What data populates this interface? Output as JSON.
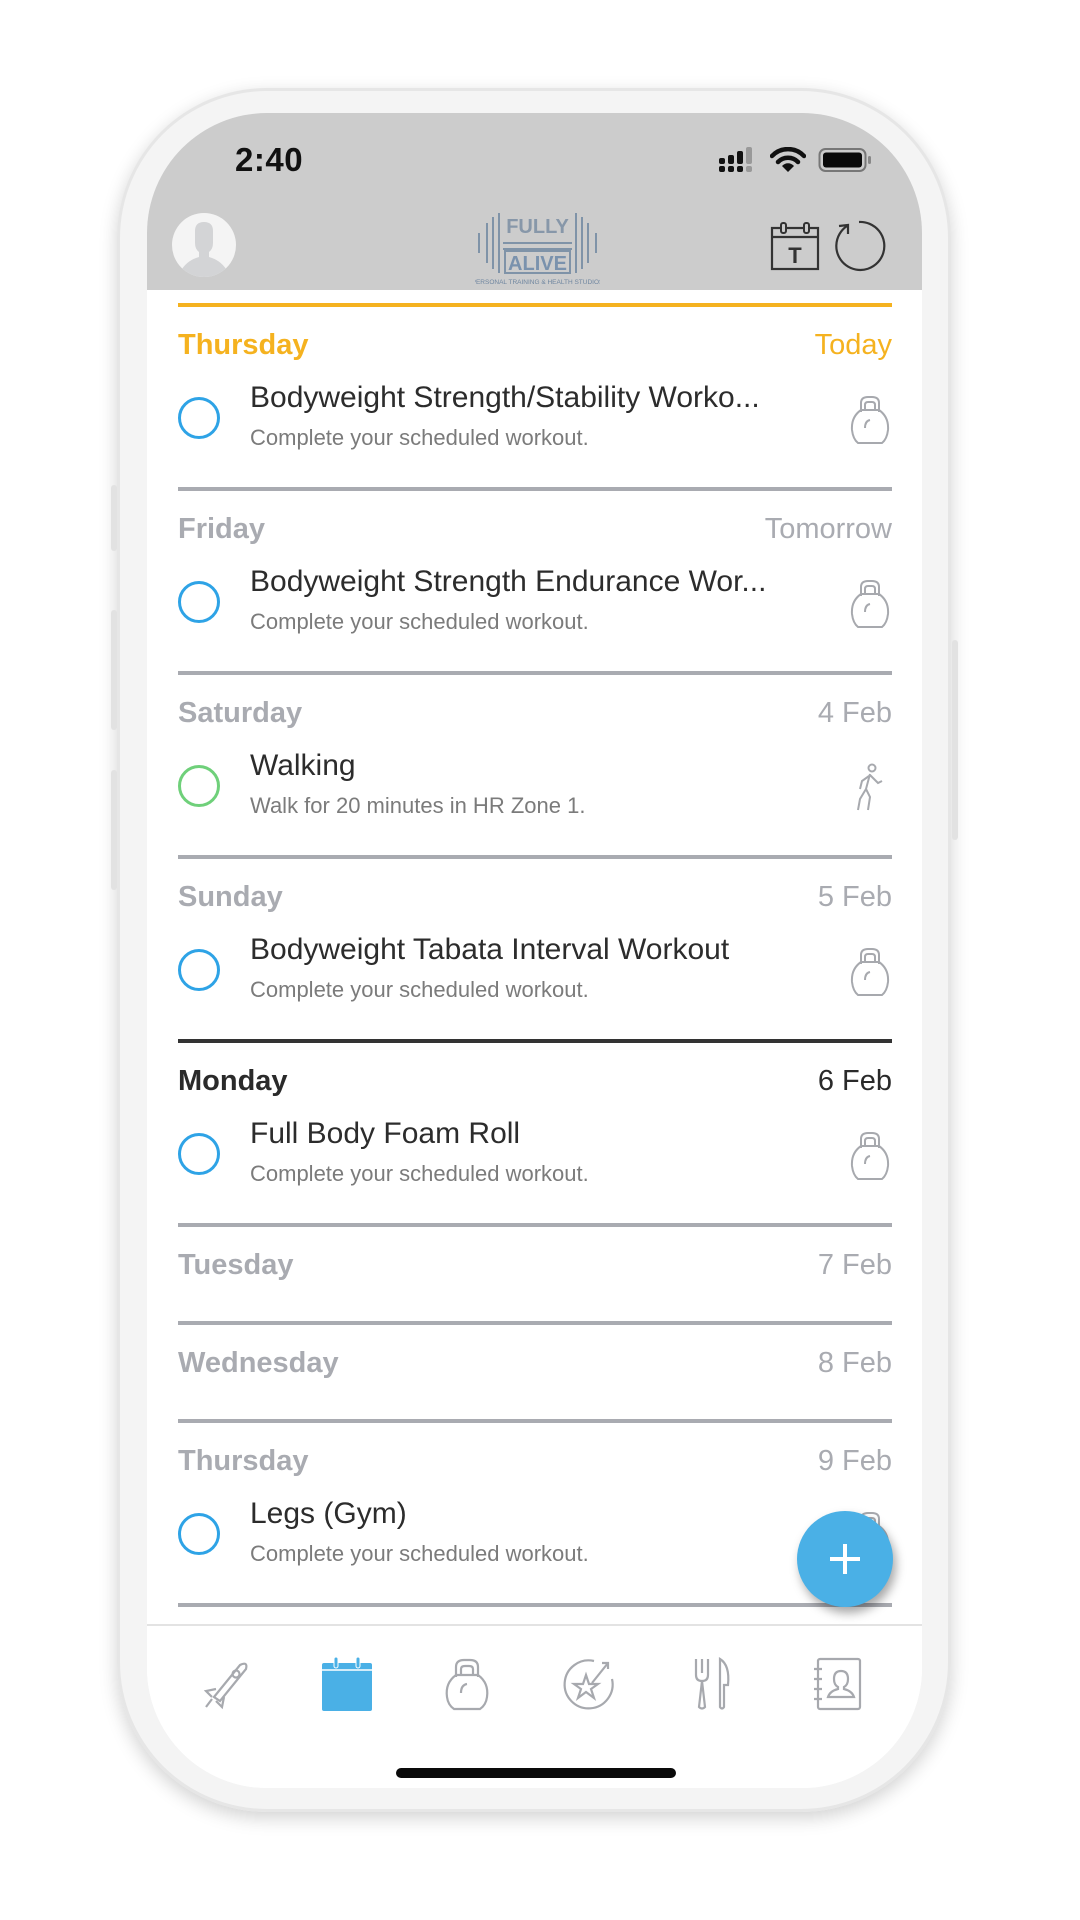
{
  "status_bar": {
    "time": "2:40",
    "icons": [
      "signal-icon",
      "wifi-icon",
      "battery-icon"
    ]
  },
  "header": {
    "avatar_icon": "user-avatar-icon",
    "logo": {
      "line1": "FULLY",
      "line2": "ALIVE",
      "tagline": "PERSONAL TRAINING & HEALTH STUDIOS"
    },
    "today_button_letter": "T",
    "today_button_icon": "calendar-today-icon",
    "refresh_icon": "refresh-icon"
  },
  "colors": {
    "accent_blue": "#4ab0e6",
    "today_yellow": "#f5b21f",
    "walk_green": "#6fd07a",
    "header_gray": "#cccccc",
    "muted": "#a9abb1"
  },
  "days": [
    {
      "name": "Thursday",
      "date": "Today",
      "state": "today",
      "items": [
        {
          "title": "Bodyweight Strength/Stability Worko...",
          "subtitle": "Complete your scheduled workout.",
          "type_icon": "kettlebell-icon",
          "check_color": "blue"
        }
      ]
    },
    {
      "name": "Friday",
      "date": "Tomorrow",
      "state": "future",
      "items": [
        {
          "title": "Bodyweight Strength Endurance Wor...",
          "subtitle": "Complete your scheduled workout.",
          "type_icon": "kettlebell-icon",
          "check_color": "blue"
        }
      ]
    },
    {
      "name": "Saturday",
      "date": "4 Feb",
      "state": "future",
      "items": [
        {
          "title": "Walking",
          "subtitle": "Walk for 20 minutes in HR Zone 1.",
          "type_icon": "walking-icon",
          "check_color": "green"
        }
      ]
    },
    {
      "name": "Sunday",
      "date": "5 Feb",
      "state": "future",
      "items": [
        {
          "title": "Bodyweight Tabata Interval Workout",
          "subtitle": "Complete your scheduled workout.",
          "type_icon": "kettlebell-icon",
          "check_color": "blue"
        }
      ]
    },
    {
      "name": "Monday",
      "date": "6 Feb",
      "state": "current",
      "items": [
        {
          "title": "Full Body Foam Roll",
          "subtitle": "Complete your scheduled workout.",
          "type_icon": "kettlebell-icon",
          "check_color": "blue"
        }
      ]
    },
    {
      "name": "Tuesday",
      "date": "7 Feb",
      "state": "future",
      "items": []
    },
    {
      "name": "Wednesday",
      "date": "8 Feb",
      "state": "future",
      "items": []
    },
    {
      "name": "Thursday",
      "date": "9 Feb",
      "state": "future",
      "items": [
        {
          "title": "Legs (Gym)",
          "subtitle": "Complete your scheduled workout.",
          "type_icon": "kettlebell-icon",
          "check_color": "blue"
        }
      ]
    }
  ],
  "fab": {
    "label": "+",
    "icon": "plus-icon"
  },
  "tabs": [
    {
      "name": "getting-started",
      "icon": "rocket-icon",
      "active": false
    },
    {
      "name": "calendar",
      "icon": "calendar-icon",
      "active": true
    },
    {
      "name": "workouts",
      "icon": "kettlebell-icon",
      "active": false
    },
    {
      "name": "goals",
      "icon": "goal-star-icon",
      "active": false
    },
    {
      "name": "nutrition",
      "icon": "fork-knife-icon",
      "active": false
    },
    {
      "name": "contacts",
      "icon": "contact-book-icon",
      "active": false
    }
  ]
}
